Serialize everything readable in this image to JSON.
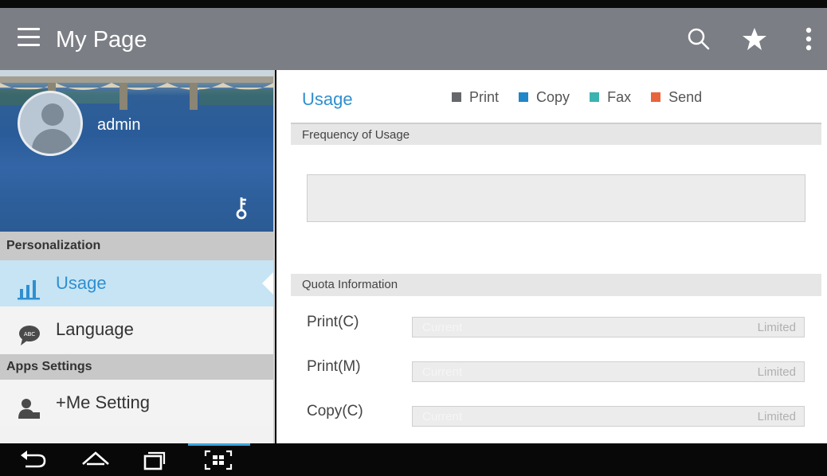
{
  "app": {
    "title": "My Page"
  },
  "toolbar": {
    "icons": [
      "menu-icon",
      "search-icon",
      "star-icon",
      "more-icon"
    ]
  },
  "profile": {
    "username": "admin"
  },
  "sidebar": {
    "sections": [
      {
        "label": "Personalization"
      },
      {
        "label": "Apps Settings"
      }
    ],
    "items": [
      {
        "label": "Usage",
        "icon": "bar-chart-icon",
        "active": true
      },
      {
        "label": "Language",
        "icon": "language-icon"
      },
      {
        "label": "+Me Setting",
        "icon": "person-setting-icon"
      }
    ]
  },
  "main": {
    "heading": "Usage",
    "legend": [
      {
        "label": "Print",
        "color": "#66676b"
      },
      {
        "label": "Copy",
        "color": "#1f86c8"
      },
      {
        "label": "Fax",
        "color": "#3bb3b0"
      },
      {
        "label": "Send",
        "color": "#e8643c"
      }
    ],
    "frequency_title": "Frequency of Usage",
    "quota_title": "Quota Information",
    "quota_rows": [
      {
        "label": "Print(C)",
        "current": "Current",
        "limited": "Limited"
      },
      {
        "label": "Print(M)",
        "current": "Current",
        "limited": "Limited"
      },
      {
        "label": "Copy(C)",
        "current": "Current",
        "limited": "Limited"
      }
    ]
  },
  "colors": {
    "accent": "#2f8fd0",
    "appbar": "#7b7e85",
    "active_bg": "#c6e4f4"
  }
}
